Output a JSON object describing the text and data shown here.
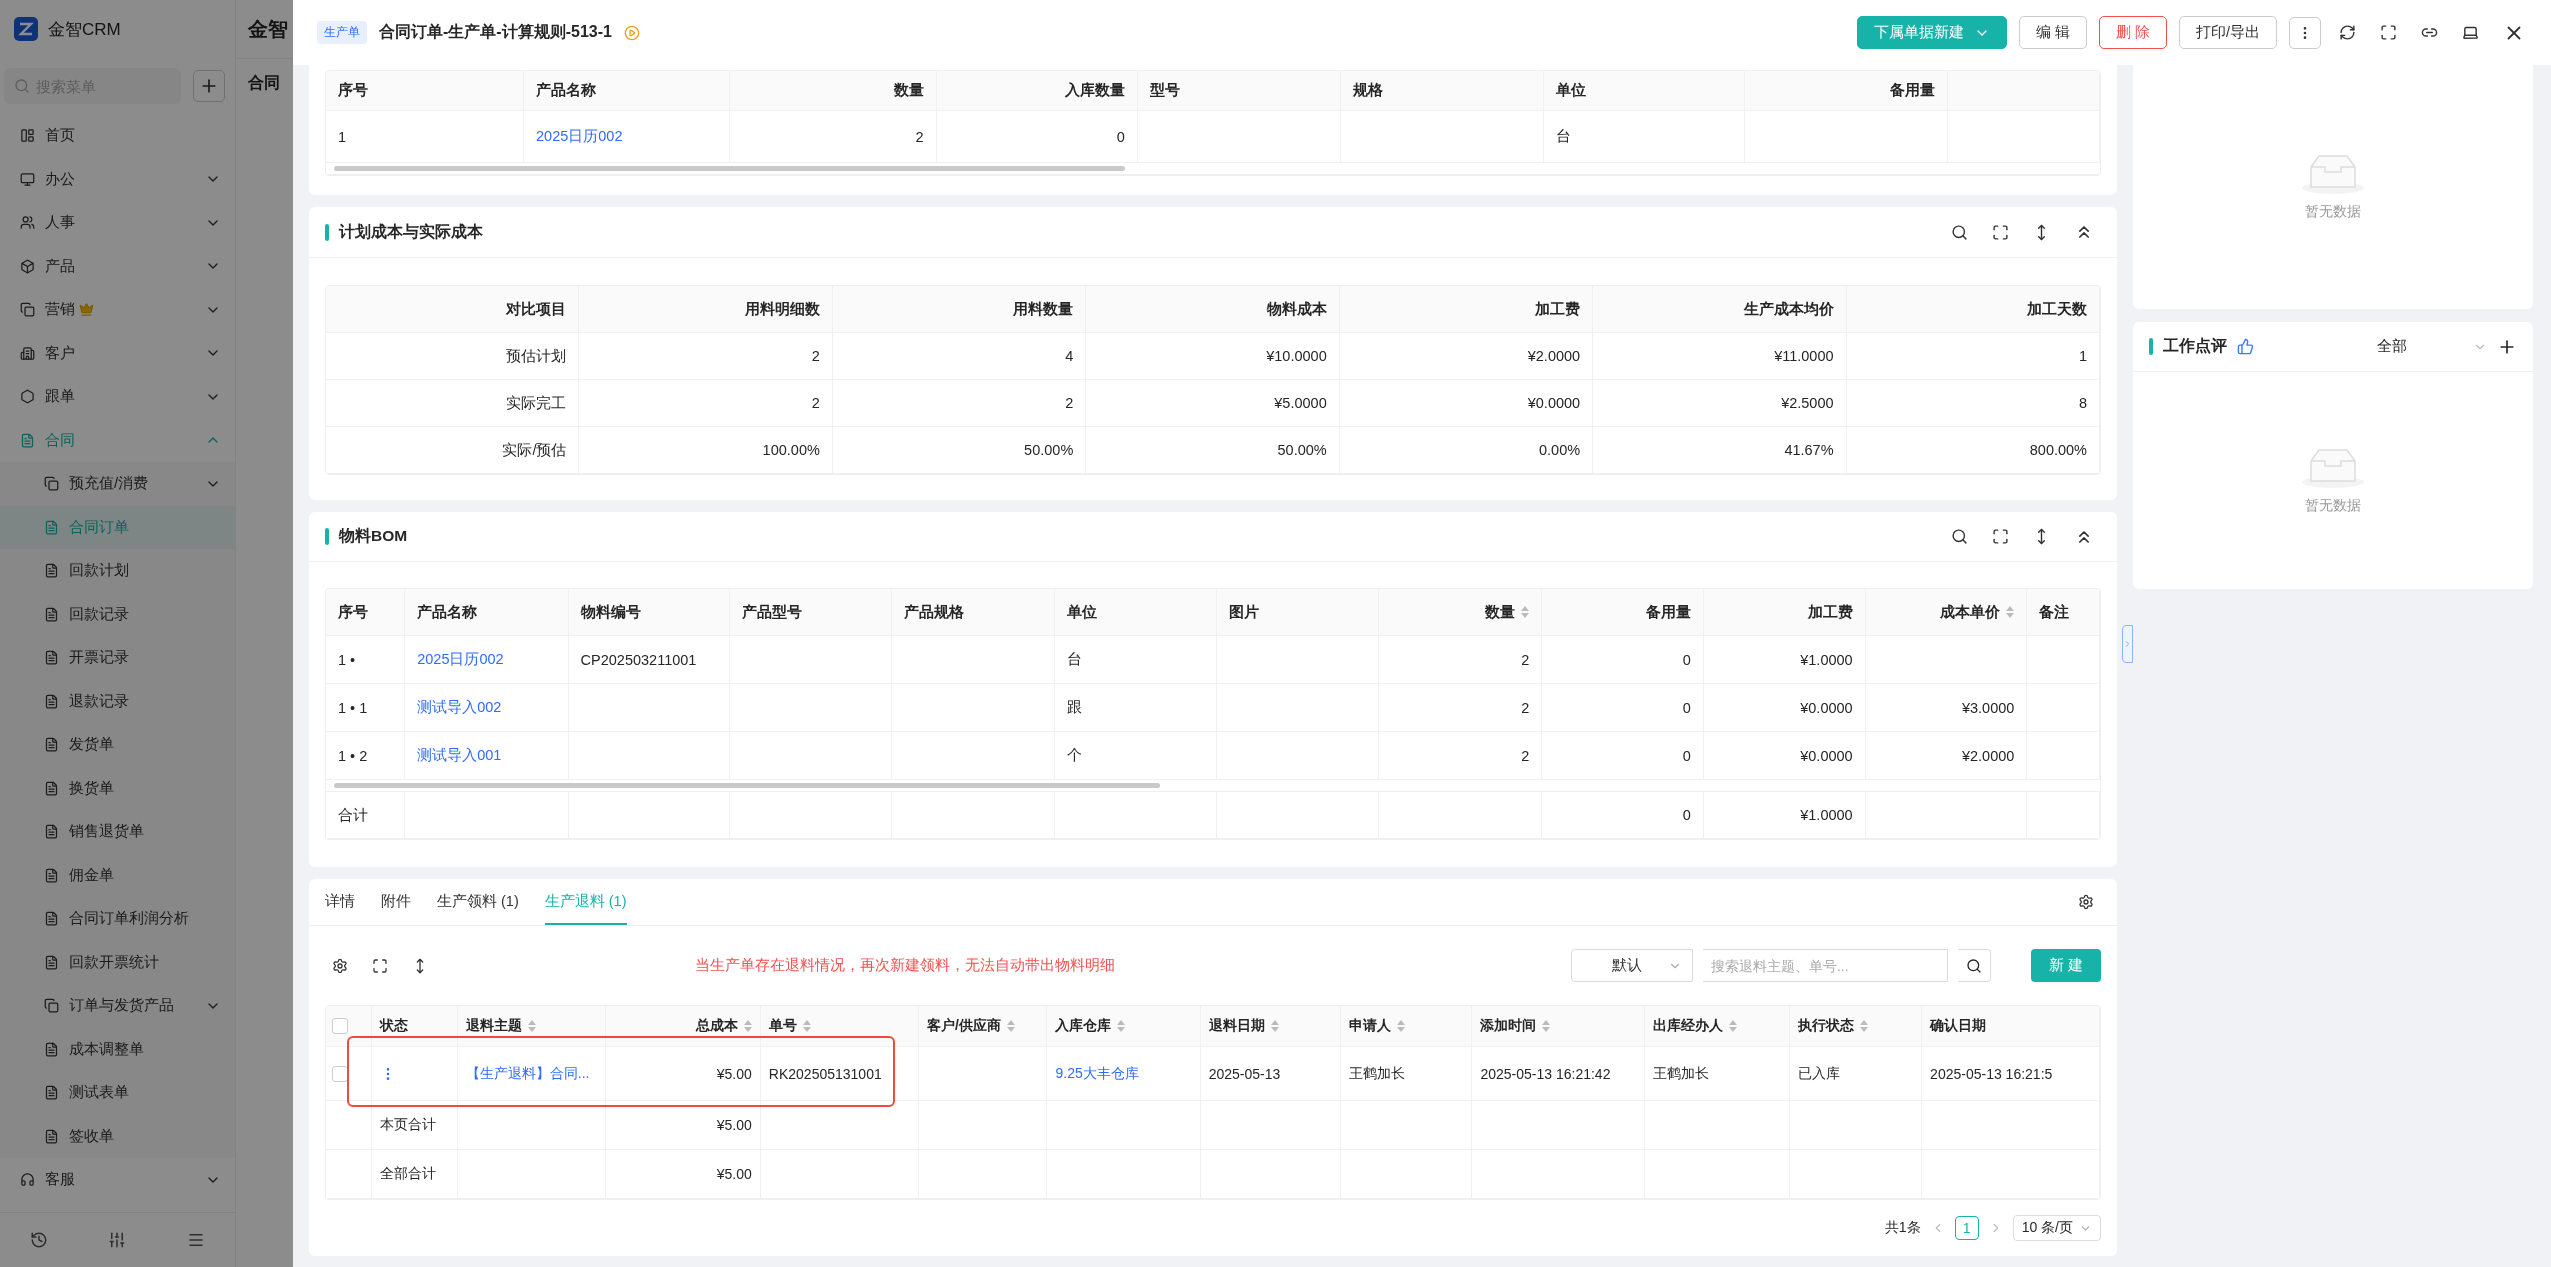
{
  "app": {
    "brand": "金智CRM",
    "search_placeholder": "搜索菜单",
    "behind_title": "金智",
    "behind_tab": "合同",
    "nav": [
      {
        "label": "首页",
        "selected": false
      },
      {
        "label": "办公",
        "expanded": false,
        "selected": false
      },
      {
        "label": "人事",
        "expanded": false,
        "selected": false
      },
      {
        "label": "产品",
        "expanded": false,
        "selected": false
      },
      {
        "label": "营销",
        "premium": true,
        "expanded": false,
        "selected": false
      },
      {
        "label": "客户",
        "expanded": false,
        "selected": false
      },
      {
        "label": "跟单",
        "expanded": false,
        "selected": false
      },
      {
        "label": "合同",
        "expanded": true,
        "selected": false,
        "children": [
          {
            "label": "预充值/消费",
            "expanded": false,
            "selected": false
          },
          {
            "label": "合同订单",
            "selected": true
          },
          {
            "label": "回款计划",
            "selected": false
          },
          {
            "label": "回款记录",
            "selected": false
          },
          {
            "label": "开票记录",
            "selected": false
          },
          {
            "label": "退款记录",
            "selected": false
          },
          {
            "label": "发货单",
            "selected": false
          },
          {
            "label": "换货单",
            "selected": false
          },
          {
            "label": "销售退货单",
            "selected": false
          },
          {
            "label": "佣金单",
            "selected": false
          },
          {
            "label": "合同订单利润分析",
            "selected": false
          },
          {
            "label": "回款开票统计",
            "selected": false
          },
          {
            "label": "订单与发货产品",
            "expanded": false,
            "selected": false
          },
          {
            "label": "成本调整单",
            "selected": false
          },
          {
            "label": "测试表单",
            "selected": false
          },
          {
            "label": "签收单",
            "selected": false
          }
        ]
      },
      {
        "label": "客服",
        "expanded": false,
        "selected": false
      }
    ]
  },
  "drawer": {
    "tag": "生产单",
    "title": "合同订单-生产单-计算规则-513-1",
    "actions": [
      {
        "label": "下属单据新建",
        "kind": "primary",
        "dropdown": true
      },
      {
        "label": "编 辑",
        "kind": "default",
        "dropdown": false
      },
      {
        "label": "删 除",
        "kind": "danger",
        "dropdown": false
      },
      {
        "label": "打印/导出",
        "kind": "default",
        "dropdown": false
      }
    ]
  },
  "order_items": {
    "columns": [
      {
        "label": "序号",
        "kind": "text"
      },
      {
        "label": "产品名称",
        "kind": "link"
      },
      {
        "label": "数量",
        "kind": "text"
      },
      {
        "label": "入库数量",
        "kind": "text"
      },
      {
        "label": "型号",
        "kind": "text"
      },
      {
        "label": "规格",
        "kind": "text"
      },
      {
        "label": "单位",
        "kind": "text"
      },
      {
        "label": "备用量",
        "kind": "text"
      }
    ],
    "rows": [
      {
        "seq": "1",
        "product": "2025日历002",
        "qty": "2",
        "in_qty": "0",
        "unit": "台"
      }
    ]
  },
  "cost_compare": {
    "title": "计划成本与实际成本",
    "columns": [
      "对比项目",
      "用料明细数",
      "用料数量",
      "物料成本",
      "加工费",
      "生产成本均价",
      "加工天数"
    ],
    "rows": [
      {
        "item": "预估计划",
        "lines": "2",
        "qty": "4",
        "material": "¥10.0000",
        "fee": "¥2.0000",
        "avg": "¥11.0000",
        "days": "1"
      },
      {
        "item": "实际完工",
        "lines": "2",
        "qty": "2",
        "material": "¥5.0000",
        "fee": "¥0.0000",
        "avg": "¥2.5000",
        "days": "8"
      },
      {
        "item": "实际/预估",
        "lines": "100.00%",
        "qty": "50.00%",
        "material": "50.00%",
        "fee": "0.00%",
        "avg": "41.67%",
        "days": "800.00%"
      }
    ]
  },
  "bom": {
    "title": "物料BOM",
    "columns": [
      {
        "label": "序号",
        "kind": "text",
        "sortable": false
      },
      {
        "label": "产品名称",
        "kind": "link",
        "sortable": false
      },
      {
        "label": "物料编号",
        "kind": "text",
        "sortable": false
      },
      {
        "label": "产品型号",
        "kind": "text",
        "sortable": false
      },
      {
        "label": "产品规格",
        "kind": "text",
        "sortable": false
      },
      {
        "label": "单位",
        "kind": "text",
        "sortable": false
      },
      {
        "label": "图片",
        "kind": "text",
        "sortable": false
      },
      {
        "label": "数量",
        "kind": "text",
        "sortable": true
      },
      {
        "label": "备用量",
        "kind": "text",
        "sortable": false
      },
      {
        "label": "加工费",
        "kind": "text",
        "sortable": false
      },
      {
        "label": "成本单价",
        "kind": "text",
        "sortable": true
      },
      {
        "label": "备注",
        "kind": "text",
        "sortable": false
      }
    ],
    "rows": [
      {
        "seq": "1 •",
        "product": "2025日历002",
        "code": "CP202503211001",
        "unit": "台",
        "qty": "2",
        "spare": "0",
        "fee": "¥1.0000"
      },
      {
        "seq": "1 • 1",
        "product": "测试导入002",
        "unit": "跟",
        "qty": "2",
        "spare": "0",
        "fee": "¥0.0000",
        "unit_cost": "¥3.0000"
      },
      {
        "seq": "1 • 2",
        "product": "测试导入001",
        "unit": "个",
        "qty": "2",
        "spare": "0",
        "fee": "¥0.0000",
        "unit_cost": "¥2.0000"
      }
    ],
    "total": {
      "seq": "合计",
      "spare": "0",
      "fee": "¥1.0000"
    }
  },
  "bottom": {
    "tabs": [
      {
        "label": "详情",
        "selected": false
      },
      {
        "label": "附件",
        "selected": false
      },
      {
        "label": "生产领料 (1)",
        "selected": false
      },
      {
        "label": "生产退料 (1)",
        "selected": true
      }
    ],
    "note": "当生产单存在退料情况，再次新建领料，无法自动带出物料明细",
    "filter": "默认",
    "search_placeholder": "搜索退料主题、单号...",
    "new_button": "新 建",
    "all_checked": false,
    "columns": [
      {
        "label": "状态",
        "kind": "status",
        "sortable": false
      },
      {
        "label": "退料主题",
        "kind": "link",
        "sortable": true
      },
      {
        "label": "总成本",
        "kind": "text",
        "sortable": true
      },
      {
        "label": "单号",
        "kind": "text",
        "sortable": true
      },
      {
        "label": "客户/供应商",
        "kind": "text",
        "sortable": true
      },
      {
        "label": "入库仓库",
        "kind": "link",
        "sortable": true
      },
      {
        "label": "退料日期",
        "kind": "text",
        "sortable": true
      },
      {
        "label": "申请人",
        "kind": "text",
        "sortable": true
      },
      {
        "label": "添加时间",
        "kind": "text",
        "sortable": true
      },
      {
        "label": "出库经办人",
        "kind": "text",
        "sortable": true
      },
      {
        "label": "执行状态",
        "kind": "text",
        "sortable": true
      },
      {
        "label": "确认日期",
        "kind": "text",
        "sortable": false
      }
    ],
    "rows": [
      {
        "checked": false,
        "subject": "【生产退料】合同...",
        "cost": "¥5.00",
        "no": "RK202505131001",
        "warehouse": "9.25大丰仓库",
        "date": "2025-05-13",
        "applicant": "王鹤加长",
        "added": "2025-05-13 16:21:42",
        "handler": "王鹤加长",
        "state": "已入库",
        "confirmed": "2025-05-13 16:21:5"
      }
    ],
    "summaries": [
      {
        "label": "本页合计",
        "total": "¥5.00"
      },
      {
        "label": "全部合计",
        "total": "¥5.00"
      }
    ],
    "pagination": {
      "total": "共1条",
      "pages": [
        {
          "label": "1",
          "selected": true
        }
      ],
      "page_size": "10 条/页"
    }
  },
  "side": {
    "first_empty": "暂无数据",
    "review_title": "工作点评",
    "review_filter": "全部",
    "review_empty": "暂无数据"
  }
}
